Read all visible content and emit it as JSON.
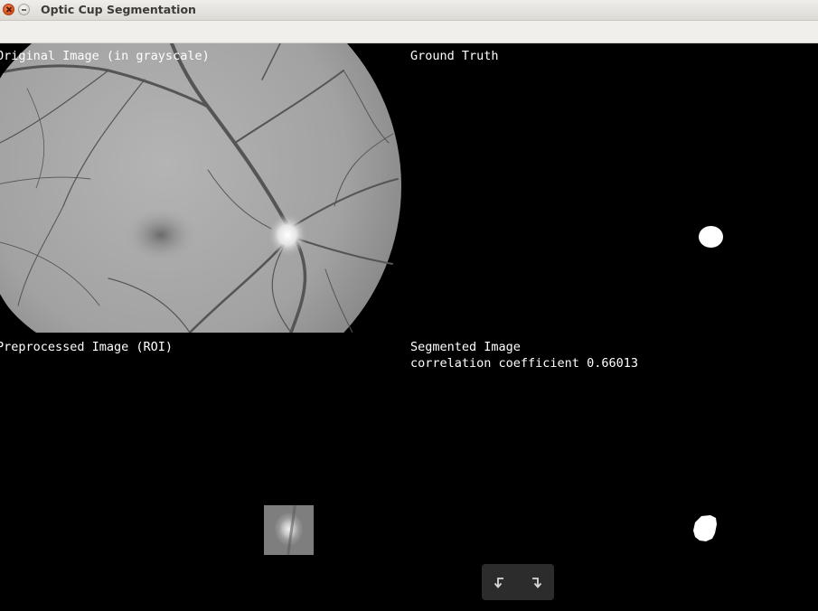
{
  "window": {
    "title": "Optic Cup Segmentation",
    "close_icon": "window-close-icon",
    "minimize_icon": "window-minimize-icon"
  },
  "panels": {
    "original": {
      "label": "Original Image (in grayscale)"
    },
    "ground_truth": {
      "label": "Ground Truth"
    },
    "preprocessed": {
      "label": "Preprocessed Image (ROI)"
    },
    "segmented": {
      "label": "Segmented Image",
      "correlation_text": "correlation coefficient 0.66013"
    }
  },
  "nav": {
    "back_icon": "undo-arrow-icon",
    "forward_icon": "redo-arrow-icon"
  },
  "colors": {
    "canvas_background": "#000000",
    "mask_foreground": "#ffffff",
    "titlebar": "#e6e4df",
    "nav_background": "#2c2c2c"
  }
}
